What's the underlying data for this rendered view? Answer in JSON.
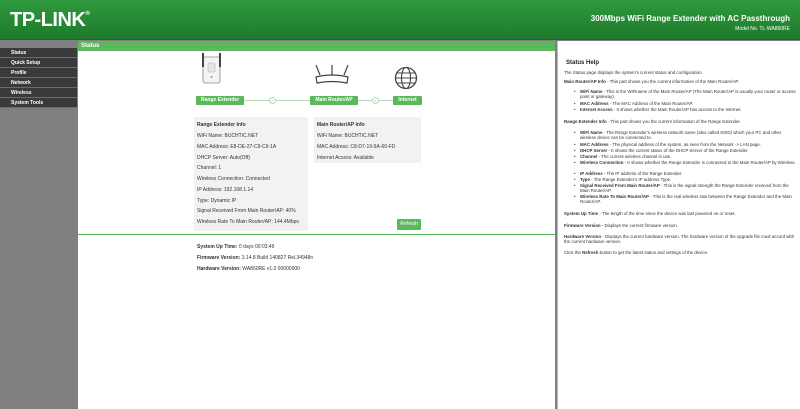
{
  "header": {
    "logo": "TP-LINK",
    "logo_tm": "®",
    "product_title": "300Mbps WiFi Range Extender with AC Passthrough",
    "model_number": "Model No. TL-WA860RE"
  },
  "sidebar": {
    "items": [
      {
        "label": "Status"
      },
      {
        "label": "Quick Setup"
      },
      {
        "label": "Profile"
      },
      {
        "label": "Network"
      },
      {
        "label": "Wireless"
      },
      {
        "label": "System Tools"
      }
    ]
  },
  "main": {
    "title": "Status",
    "topology": {
      "range_extender": "Range Extender",
      "main_router": "Main Router/AP",
      "internet": "Internet",
      "check_glyph": "✓"
    },
    "range_extender_info": {
      "heading": "Range Extender Info",
      "wifi_name": "WiFi Name: BUCHTIC.NET",
      "mac": "MAC Address: E8-DE-27-C9-C9-1A",
      "dhcp": "DHCP Server: Auto(Off)",
      "channel": "Channel: 1",
      "wireless_connection": "Wireless Connection: Connected",
      "ip": "IP Address: 192.168.1.14",
      "type": "Type: Dynamic IP",
      "signal": "Signal Received From Main Router/AP: 40%",
      "rate": "Wireless Rate To Main Router/AP: 144.4Mbps"
    },
    "main_router_info": {
      "heading": "Main Router/AP Info",
      "wifi_name": "WiFi Name: BUCHTIC.NET",
      "mac": "MAC Address: C8-D7-19-9A-60-FD",
      "internet_access": "Internet Access: Available"
    },
    "refresh_label": "Refresh",
    "system": {
      "uptime_label": "System Up Time:",
      "uptime_value": "0 days 00:03:49",
      "firmware_label": "Firmware Version:",
      "firmware_value": "3.14.8 Build 140827 Rel.34948n",
      "hardware_label": "Hardware Version:",
      "hardware_value": "WA860RE v1.0 00000000"
    }
  },
  "help": {
    "title": "Status Help",
    "intro": "The Status page displays the system's current status and configuration.",
    "router_info_head": "Main Router/AP Info",
    "router_info_text": " - This part shows you the current information of the Main Router/AP.",
    "router_bullets": [
      {
        "term": "WiFi Name",
        "text": " - This is the WiFiname of the Main Router/AP (The Main Router/AP is usually your router or access point or gateway)."
      },
      {
        "term": "MAC Address",
        "text": " - The MAC Address of the Main Router/AP."
      },
      {
        "term": "Internet Access",
        "text": " - It shows whether the Main Router/AP has access to the Internet."
      }
    ],
    "ext_info_head": "Range Extender Info",
    "ext_info_text": " - This part shows you the current information of the Range Extender.",
    "ext_bullets": [
      {
        "term": "WiFi Name",
        "text": " - The Range Extender's wireless network name (also called SSID) which your PC and other wireless device can be connected to."
      },
      {
        "term": "MAC Address",
        "text": " - The physical address of the system, as seen from the Network -> LAN page."
      },
      {
        "term": "DHCP Server",
        "text": " - It shows the current status of the DHCP Server of the Range Extender."
      },
      {
        "term": "Channel",
        "text": " - The current wireless channel in use."
      },
      {
        "term": "Wireless Connection",
        "text": " - It shows whether the Range Extender is connected to the Main Router/AP by Wireless."
      },
      {
        "term": "IP Address",
        "text": " - The IP address of the Range Extender."
      },
      {
        "term": "Type",
        "text": " - The Range Extender's IP address Type."
      },
      {
        "term": "Signal Received From Main Router/AP",
        "text": " - This is the signal strength the Range Extender received from the Main Router/AP."
      },
      {
        "term": "Wireless Rate To Main Router/AP",
        "text": " - This is the real wireless rate between the Range Extender and the Main Router/AP."
      }
    ],
    "uptime_head": "System Up Time",
    "uptime_text": " - The length of the time since the device was last powered on or reset.",
    "firmware_head": "Firmware Version",
    "firmware_text": " - Displays the current firmware version.",
    "hardware_head": "Hardware Version",
    "hardware_text": " - Displays the current hardware version. The hardware version of the upgrade file must accord with the current hardware version.",
    "refresh_pre": "Click the ",
    "refresh_term": "Refresh",
    "refresh_post": " button to get the latest status and settings of the device."
  }
}
